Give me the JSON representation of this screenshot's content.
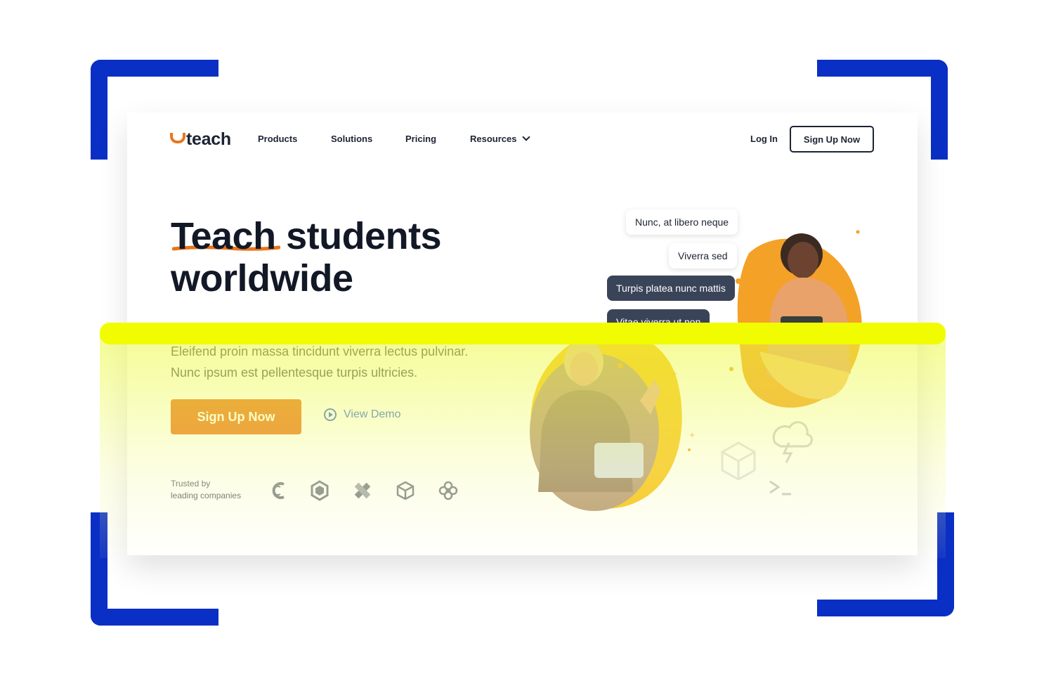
{
  "brand": {
    "logo_text": "teach",
    "accent": "#e8761d",
    "bracket_color": "#0a2fc4",
    "highlight_color": "#f2fc00"
  },
  "nav": {
    "items": [
      {
        "label": "Products"
      },
      {
        "label": "Solutions"
      },
      {
        "label": "Pricing"
      },
      {
        "label": "Resources"
      }
    ],
    "login": "Log In",
    "signup": "Sign Up Now"
  },
  "hero": {
    "title_line1": "Teach students",
    "title_line2": "worldwide",
    "subtitle_line1": "Eleifend proin massa tincidunt viverra lectus pulvinar.",
    "subtitle_line2": "Nunc ipsum est pellentesque turpis ultricies.",
    "cta": "Sign Up Now",
    "demo": "View Demo"
  },
  "trusted": {
    "line1": "Trusted by",
    "line2": "leading companies",
    "logos": [
      "c-mark-icon",
      "hexagon-icon",
      "x-knot-icon",
      "cube-icon",
      "flower-icon"
    ]
  },
  "chat": [
    {
      "text": "Nunc, at libero neque",
      "style": "light"
    },
    {
      "text": "Viverra sed",
      "style": "light"
    },
    {
      "text": "Turpis platea nunc mattis",
      "style": "dark"
    },
    {
      "text": "Vitae viverra ut non",
      "style": "dark"
    }
  ],
  "decor_icons": [
    "cube-outline-icon",
    "storm-cloud-icon",
    "terminal-icon"
  ]
}
